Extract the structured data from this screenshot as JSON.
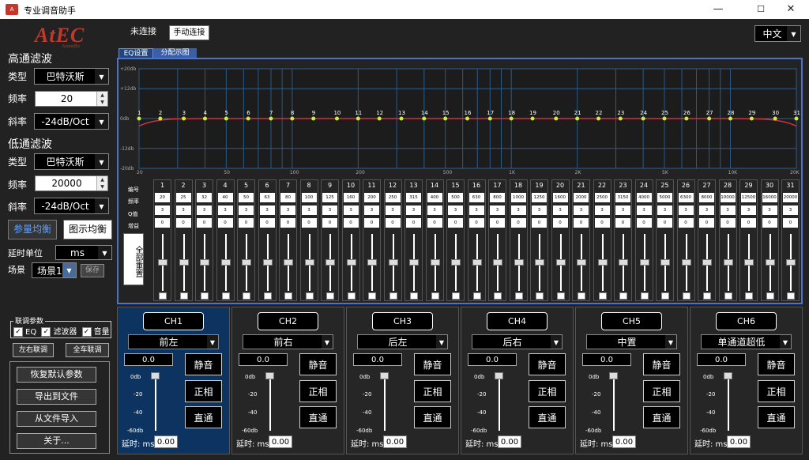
{
  "window": {
    "title": "专业调音助手",
    "minimize": "—",
    "maximize": "☐",
    "close": "✕"
  },
  "logo": {
    "text": "AtEC",
    "sub": "AcoustEc"
  },
  "status": {
    "connection": "未连接",
    "connect_button": "手动连接"
  },
  "language": "中文",
  "tabs": [
    {
      "label": "EQ设置",
      "active": true
    },
    {
      "label": "分配示图",
      "active": false
    }
  ],
  "highpass": {
    "header": "高通滤波",
    "type_label": "类型",
    "type_value": "巴特沃斯",
    "freq_label": "频率",
    "freq_value": "20",
    "slope_label": "斜率",
    "slope_value": "-24dB/Oct"
  },
  "lowpass": {
    "header": "低通滤波",
    "type_label": "类型",
    "type_value": "巴特沃斯",
    "freq_label": "频率",
    "freq_value": "20000",
    "slope_label": "斜率",
    "slope_value": "-24dB/Oct"
  },
  "eq_mode": {
    "parametric": "参量均衡",
    "graphic": "图示均衡"
  },
  "delay_unit": {
    "label": "延时单位",
    "value": "ms"
  },
  "scene": {
    "label": "场景",
    "value": "场景1",
    "save": "保存"
  },
  "link": {
    "title": "联调参数",
    "eq": "EQ",
    "filter": "滤波器",
    "volume": "音量",
    "lr_link": "左右联调",
    "all_link": "全车联调"
  },
  "actions": {
    "restore": "恢复默认参数",
    "export": "导出到文件",
    "import": "从文件导入",
    "about": "关于..."
  },
  "graph": {
    "y_ticks": [
      "+20db",
      "+12db",
      "0db",
      "-12db",
      "-20db"
    ],
    "x_ticks": [
      "20",
      "50",
      "100",
      "200",
      "500",
      "1K",
      "2K",
      "5K",
      "10K",
      "20K"
    ],
    "curve_color": "#d0303a"
  },
  "band_rows": {
    "num": "编号",
    "freq": "频率",
    "q": "Q值",
    "gain": "增益"
  },
  "reset_all": "全部重置",
  "bands": [
    {
      "n": "1",
      "f": "20",
      "q": "3",
      "g": "0"
    },
    {
      "n": "2",
      "f": "25",
      "q": "3",
      "g": "0"
    },
    {
      "n": "3",
      "f": "32",
      "q": "3",
      "g": "0"
    },
    {
      "n": "4",
      "f": "40",
      "q": "3",
      "g": "0"
    },
    {
      "n": "5",
      "f": "50",
      "q": "3",
      "g": "0"
    },
    {
      "n": "6",
      "f": "63",
      "q": "3",
      "g": "0"
    },
    {
      "n": "7",
      "f": "80",
      "q": "3",
      "g": "0"
    },
    {
      "n": "8",
      "f": "100",
      "q": "3",
      "g": "0"
    },
    {
      "n": "9",
      "f": "125",
      "q": "3",
      "g": "0"
    },
    {
      "n": "10",
      "f": "160",
      "q": "3",
      "g": "0"
    },
    {
      "n": "11",
      "f": "200",
      "q": "3",
      "g": "0"
    },
    {
      "n": "12",
      "f": "250",
      "q": "3",
      "g": "0"
    },
    {
      "n": "13",
      "f": "315",
      "q": "3",
      "g": "0"
    },
    {
      "n": "14",
      "f": "400",
      "q": "3",
      "g": "0"
    },
    {
      "n": "15",
      "f": "500",
      "q": "3",
      "g": "0"
    },
    {
      "n": "16",
      "f": "630",
      "q": "3",
      "g": "0"
    },
    {
      "n": "17",
      "f": "800",
      "q": "3",
      "g": "0"
    },
    {
      "n": "18",
      "f": "1000",
      "q": "3",
      "g": "0"
    },
    {
      "n": "19",
      "f": "1250",
      "q": "3",
      "g": "0"
    },
    {
      "n": "20",
      "f": "1600",
      "q": "3",
      "g": "0"
    },
    {
      "n": "21",
      "f": "2000",
      "q": "3",
      "g": "0"
    },
    {
      "n": "22",
      "f": "2500",
      "q": "3",
      "g": "0"
    },
    {
      "n": "23",
      "f": "3150",
      "q": "3",
      "g": "0"
    },
    {
      "n": "24",
      "f": "4000",
      "q": "3",
      "g": "0"
    },
    {
      "n": "25",
      "f": "5000",
      "q": "3",
      "g": "0"
    },
    {
      "n": "26",
      "f": "6300",
      "q": "3",
      "g": "0"
    },
    {
      "n": "27",
      "f": "8000",
      "q": "3",
      "g": "0"
    },
    {
      "n": "28",
      "f": "10000",
      "q": "3",
      "g": "0"
    },
    {
      "n": "29",
      "f": "12500",
      "q": "3",
      "g": "0"
    },
    {
      "n": "30",
      "f": "16000",
      "q": "3",
      "g": "0"
    },
    {
      "n": "31",
      "f": "20000",
      "q": "3",
      "g": "0"
    }
  ],
  "channel_scale": [
    "0db",
    "-20",
    "-40",
    "-60db"
  ],
  "channel_common": {
    "mute": "静音",
    "phase": "正相",
    "bypass": "直通",
    "delay_label": "延时: ms"
  },
  "channels": [
    {
      "name": "CH1",
      "position": "前左",
      "volume": "0.0",
      "delay": "0.00",
      "selected": true
    },
    {
      "name": "CH2",
      "position": "前右",
      "volume": "0.0",
      "delay": "0.00",
      "selected": false
    },
    {
      "name": "CH3",
      "position": "后左",
      "volume": "0.0",
      "delay": "0.00",
      "selected": false
    },
    {
      "name": "CH4",
      "position": "后右",
      "volume": "0.0",
      "delay": "0.00",
      "selected": false
    },
    {
      "name": "CH5",
      "position": "中置",
      "volume": "0.0",
      "delay": "0.00",
      "selected": false
    },
    {
      "name": "CH6",
      "position": "单通道超低",
      "volume": "0.0",
      "delay": "0.00",
      "selected": false
    }
  ]
}
